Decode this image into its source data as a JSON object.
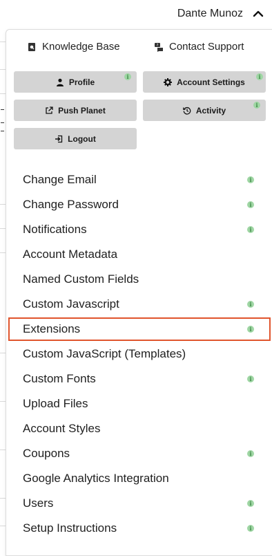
{
  "header": {
    "user_name": "Dante Munoz",
    "toggle_icon": "chevron-up-icon"
  },
  "quick_links": [
    {
      "label": "Knowledge Base",
      "icon": "book-icon"
    },
    {
      "label": "Contact Support",
      "icon": "support-chat-icon"
    }
  ],
  "buttons": [
    {
      "label": "Profile",
      "icon": "user-icon",
      "info_badge": true
    },
    {
      "label": "Account Settings",
      "icon": "gear-icon",
      "info_badge": true
    },
    {
      "label": "Push Planet",
      "icon": "external-link-icon",
      "info_badge": false
    },
    {
      "label": "Activity",
      "icon": "history-icon",
      "info_badge": true
    },
    {
      "label": "Logout",
      "icon": "logout-icon",
      "info_badge": false
    }
  ],
  "menu_items": [
    {
      "label": "Change Email",
      "info_badge": true
    },
    {
      "label": "Change Password",
      "info_badge": true
    },
    {
      "label": "Notifications",
      "info_badge": true
    },
    {
      "label": "Account Metadata",
      "info_badge": false
    },
    {
      "label": "Named Custom Fields",
      "info_badge": false
    },
    {
      "label": "Custom Javascript",
      "info_badge": true
    },
    {
      "label": "Extensions",
      "info_badge": true,
      "highlighted": true
    },
    {
      "label": "Custom JavaScript (Templates)",
      "info_badge": false
    },
    {
      "label": "Custom Fonts",
      "info_badge": true
    },
    {
      "label": "Upload Files",
      "info_badge": false
    },
    {
      "label": "Account Styles",
      "info_badge": false
    },
    {
      "label": "Coupons",
      "info_badge": true
    },
    {
      "label": "Google Analytics Integration",
      "info_badge": false
    },
    {
      "label": "Users",
      "info_badge": true
    },
    {
      "label": "Setup Instructions",
      "info_badge": true
    }
  ],
  "badge_glyph": "i",
  "colors": {
    "button_bg": "#d4d4d4",
    "badge_bg": "#9fd6a4",
    "highlight": "#e0542c"
  }
}
